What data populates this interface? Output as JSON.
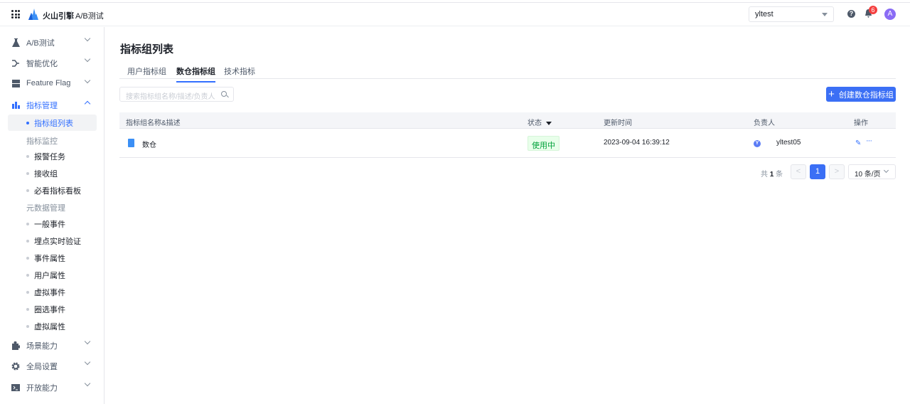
{
  "header": {
    "brand": "火山引擎",
    "product": "A/B测试",
    "project": "yltest",
    "notifications": "6",
    "avatar": "A",
    "help": "?"
  },
  "sidebar": {
    "top": [
      {
        "label": "A/B测试",
        "icon": "flask-icon"
      },
      {
        "label": "智能优化",
        "icon": "branch-icon"
      },
      {
        "label": "Feature Flag",
        "icon": "server-icon"
      },
      {
        "label": "指标管理",
        "icon": "bar-chart-icon"
      }
    ],
    "sub1": [
      "指标组列表"
    ],
    "group1": "指标监控",
    "sub2": [
      "报警任务",
      "接收组",
      "必看指标看板"
    ],
    "group2": "元数据管理",
    "sub3": [
      "一般事件",
      "埋点实时验证",
      "事件属性",
      "用户属性",
      "虚拟事件",
      "圈选事件",
      "虚拟属性"
    ],
    "bottom": [
      {
        "label": "场景能力",
        "icon": "puzzle-icon"
      },
      {
        "label": "全局设置",
        "icon": "gear-icon"
      },
      {
        "label": "开放能力",
        "icon": "terminal-icon"
      }
    ]
  },
  "main": {
    "title": "指标组列表",
    "tabs": [
      "用户指标组",
      "数仓指标组",
      "技术指标"
    ],
    "active_tab": "数仓指标组",
    "search_placeholder": "搜索指标组名称/描述/负责人",
    "create_label": "创建数仓指标组",
    "columns": [
      "指标组名称&描述",
      "状态",
      "更新时间",
      "负责人",
      "操作"
    ],
    "rows": [
      {
        "name": "数仓",
        "status": "使用中",
        "updated": "2023-09-04 16:39:12",
        "owner": "yltest05",
        "owner_initial": "Y"
      }
    ],
    "pagination": {
      "total_prefix": "共",
      "total": "1",
      "total_suffix": "条",
      "current": "1",
      "prev": "<",
      "next": ">",
      "page_size": "10 条/页"
    }
  },
  "colors": {
    "accent": "#3370ff",
    "status_green": "#00a13a"
  }
}
